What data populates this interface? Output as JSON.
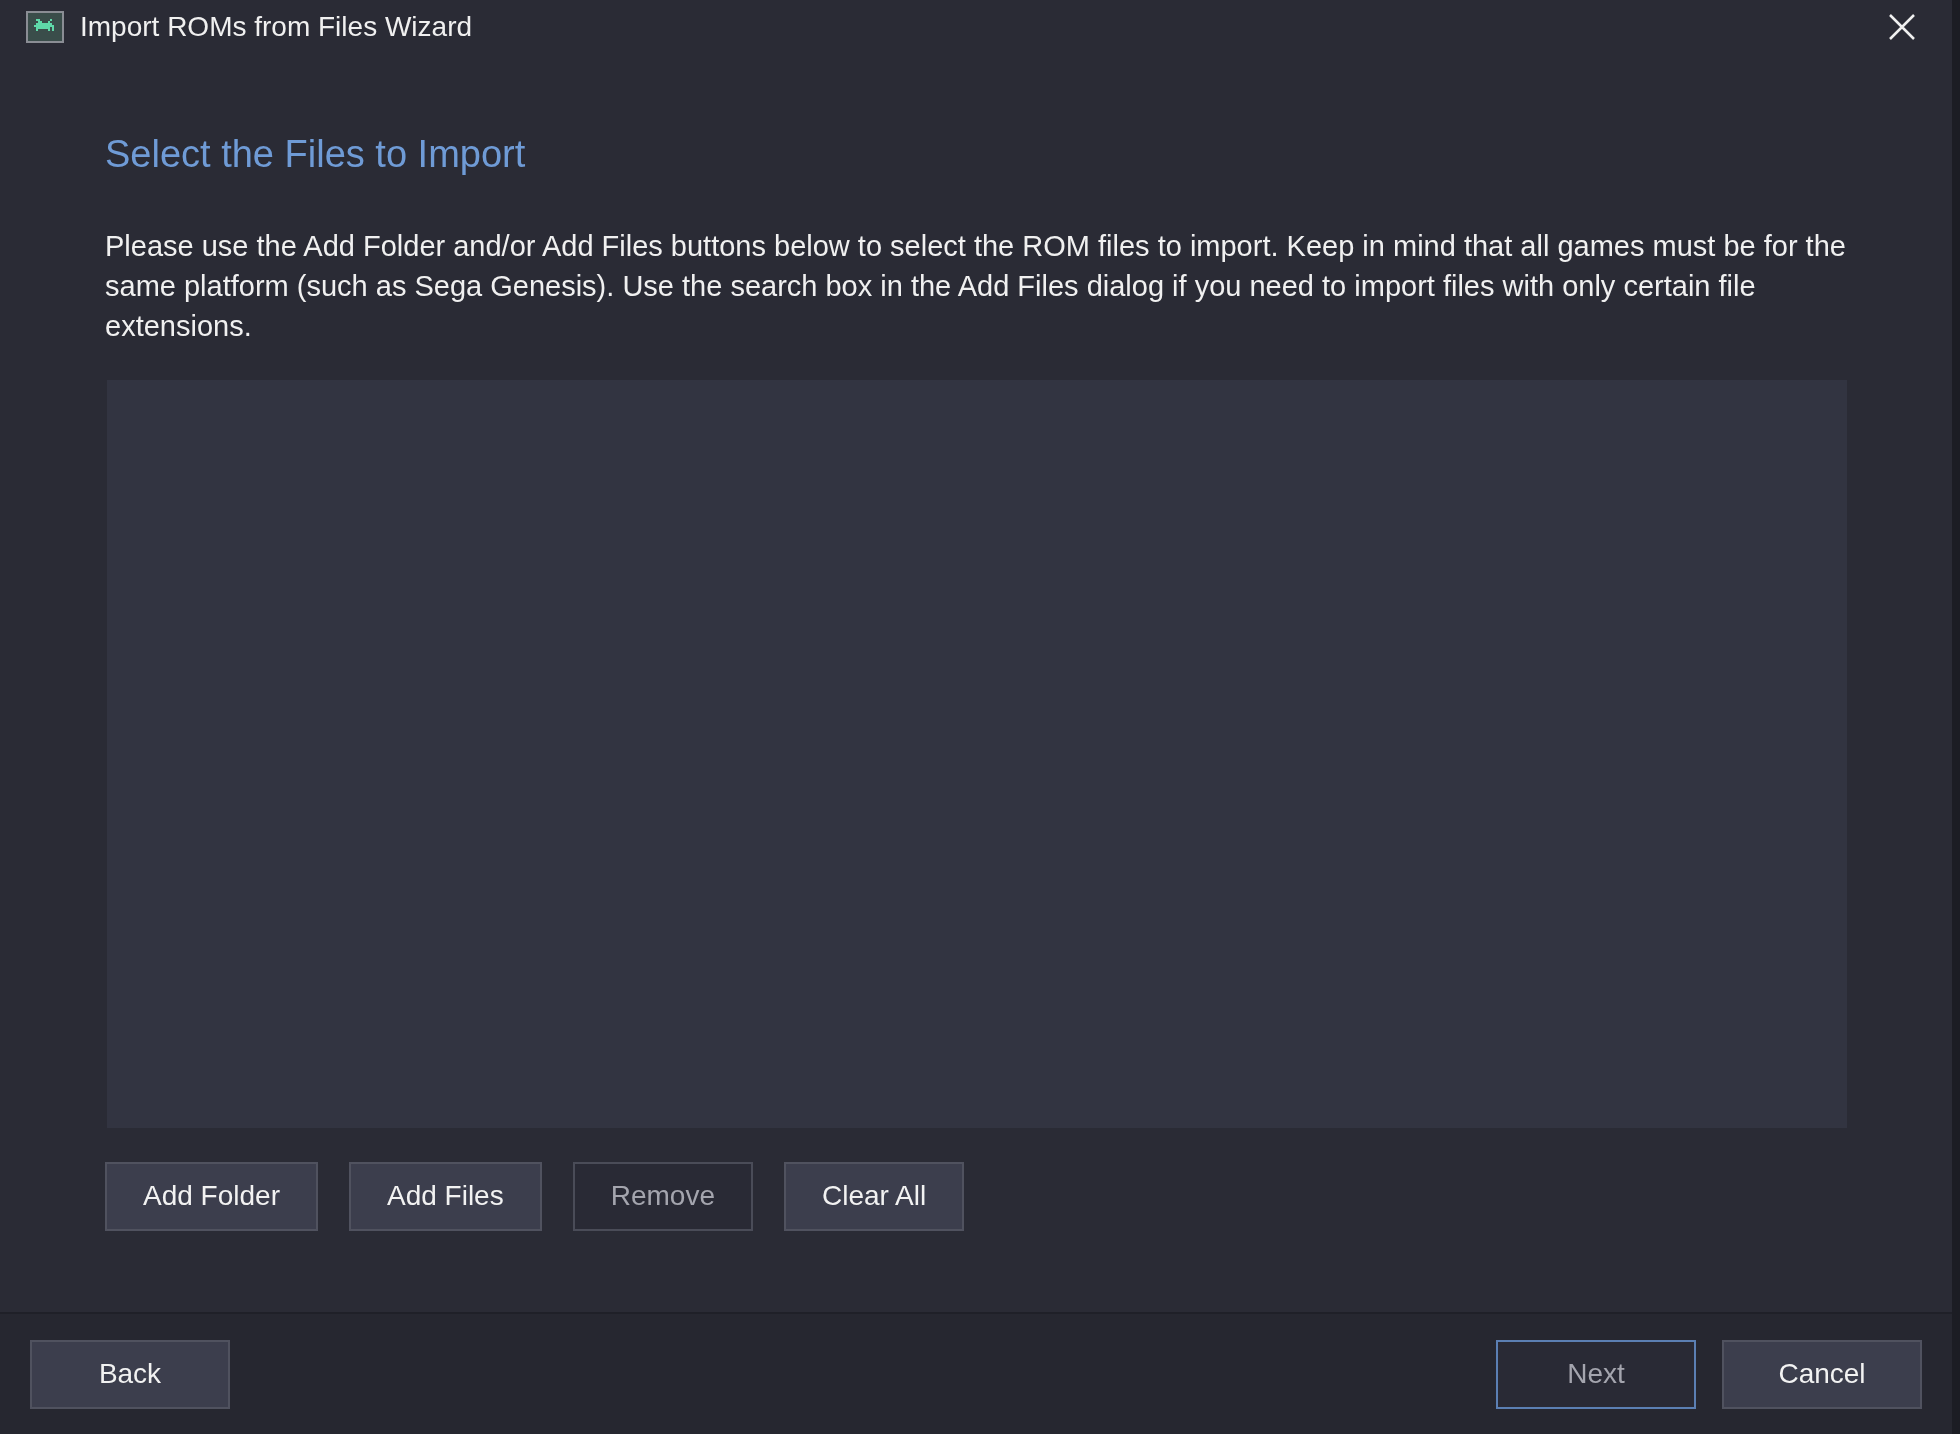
{
  "window": {
    "title": "Import ROMs from Files Wizard"
  },
  "page": {
    "heading": "Select the Files to Import",
    "description": "Please use the Add Folder and/or Add Files buttons below to select the ROM files to import. Keep in mind that all games must be for the same platform (such as Sega Genesis). Use the search box in the Add Files dialog if you need to import files with only certain file extensions."
  },
  "file_buttons": [
    {
      "label": "Add Folder",
      "disabled": false
    },
    {
      "label": "Add Files",
      "disabled": false
    },
    {
      "label": "Remove",
      "disabled": true
    },
    {
      "label": "Clear All",
      "disabled": false
    }
  ],
  "footer": {
    "left_buttons": [
      {
        "label": "Back",
        "disabled": false,
        "focused": false
      }
    ],
    "right_buttons": [
      {
        "label": "Next",
        "disabled": true,
        "focused": true
      },
      {
        "label": "Cancel",
        "disabled": false,
        "focused": false
      }
    ]
  }
}
